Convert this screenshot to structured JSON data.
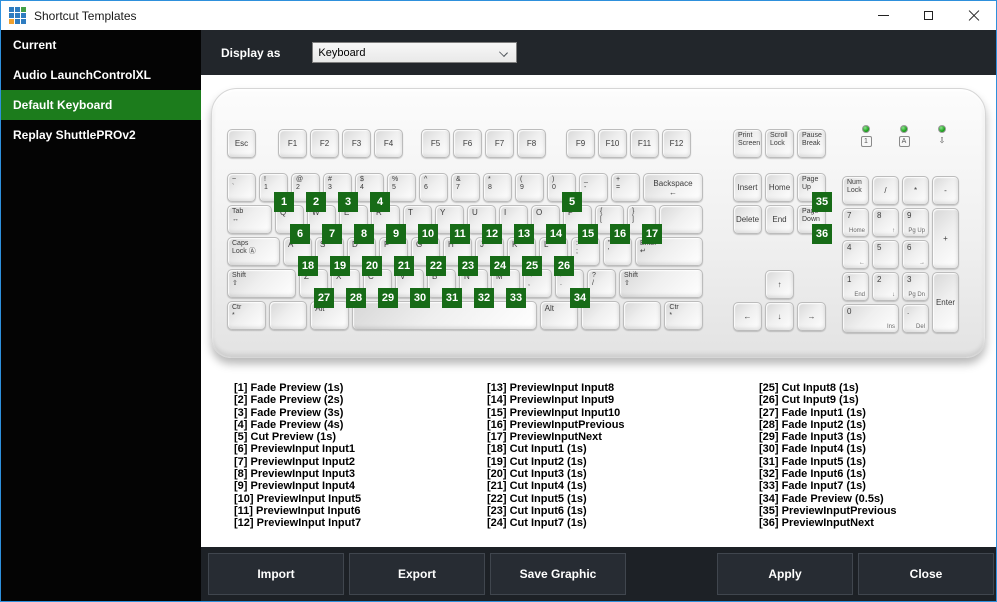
{
  "colors": {
    "accent_blue": "#2e90dc",
    "sidebar_bg": "#040404",
    "selected_green": "#1c7c1c",
    "badge_green": "#176b17",
    "header_bg": "#22262b",
    "footer_bg": "#1d2126",
    "button_bg": "#272c33",
    "button_border": "#40464e",
    "content_bg": "#ffffff"
  },
  "window": {
    "title": "Shortcut Templates",
    "app_icon_grid": [
      "#2e7cc0",
      "#2e7cc0",
      "#43a047",
      "#2e7cc0",
      "#2e7cc0",
      "#2e7cc0",
      "#f0a02c",
      "#2e7cc0",
      "#2e7cc0"
    ]
  },
  "sidebar": {
    "items": [
      {
        "label": "Current",
        "selected": false
      },
      {
        "label": "Audio LaunchControlXL",
        "selected": false
      },
      {
        "label": "Default Keyboard",
        "selected": true
      },
      {
        "label": "Replay ShuttlePROv2",
        "selected": false
      }
    ]
  },
  "header": {
    "label": "Display as",
    "dropdown_value": "Keyboard"
  },
  "keyboard": {
    "leds": [
      {
        "glyph": "1",
        "boxed": true
      },
      {
        "glyph": "A",
        "boxed": true
      },
      {
        "glyph": "⇩",
        "boxed": false
      }
    ],
    "main_rows": [
      [
        {
          "l": "Esc",
          "c": 1
        },
        {
          "sp": 16
        },
        {
          "l": "F1",
          "c": 1
        },
        {
          "l": "F2",
          "c": 1
        },
        {
          "l": "F3",
          "c": 1
        },
        {
          "l": "F4",
          "c": 1
        },
        {
          "sp": 12
        },
        {
          "l": "F5",
          "c": 1
        },
        {
          "l": "F6",
          "c": 1
        },
        {
          "l": "F7",
          "c": 1
        },
        {
          "l": "F8",
          "c": 1
        },
        {
          "sp": 14
        },
        {
          "l": "F9",
          "c": 1
        },
        {
          "l": "F10",
          "c": 1
        },
        {
          "l": "F11",
          "c": 1
        },
        {
          "l": "F12",
          "c": 1
        }
      ],
      [
        {
          "t": "~",
          "b": "`"
        },
        {
          "t": "!",
          "b": "1",
          "badge": "1"
        },
        {
          "t": "@",
          "b": "2",
          "badge": "2"
        },
        {
          "t": "#",
          "b": "3",
          "badge": "3"
        },
        {
          "t": "$",
          "b": "4",
          "badge": "4"
        },
        {
          "t": "%",
          "b": "5"
        },
        {
          "t": "^",
          "b": "6"
        },
        {
          "t": "&",
          "b": "7"
        },
        {
          "t": "*",
          "b": "8"
        },
        {
          "t": "(",
          "b": "9"
        },
        {
          "t": ")",
          "b": "0",
          "badge": "5"
        },
        {
          "t": "_",
          "b": "-"
        },
        {
          "t": "+",
          "b": "="
        },
        {
          "l": "Backspace",
          "i": "←",
          "fill": 1,
          "c": 1
        }
      ],
      [
        {
          "t": "Tab",
          "b": "↔",
          "w": 1.5
        },
        {
          "l": "Q",
          "badge": "6"
        },
        {
          "l": "W",
          "badge": "7"
        },
        {
          "l": "E",
          "badge": "8"
        },
        {
          "l": "R",
          "badge": "9"
        },
        {
          "l": "T",
          "badge": "10"
        },
        {
          "l": "Y",
          "badge": "11"
        },
        {
          "l": "U",
          "badge": "12"
        },
        {
          "l": "I",
          "badge": "13"
        },
        {
          "l": "O",
          "badge": "14"
        },
        {
          "l": "P",
          "badge": "15"
        },
        {
          "t": "{",
          "b": "[",
          "badge": "16"
        },
        {
          "t": "}",
          "b": "]",
          "badge": "17"
        },
        {
          "blank": 1,
          "fill": 1
        }
      ],
      [
        {
          "t": "Caps",
          "b": "Lock Ⓐ",
          "w": 1.75
        },
        {
          "l": "A",
          "badge": "18"
        },
        {
          "l": "S",
          "badge": "19"
        },
        {
          "l": "D",
          "badge": "20"
        },
        {
          "l": "F",
          "badge": "21"
        },
        {
          "l": "G",
          "badge": "22"
        },
        {
          "l": "H",
          "badge": "23"
        },
        {
          "l": "J",
          "badge": "24"
        },
        {
          "l": "K",
          "badge": "25"
        },
        {
          "l": "L",
          "badge": "26"
        },
        {
          "t": ":",
          "b": ";"
        },
        {
          "t": "\"",
          "b": "'"
        },
        {
          "t": "Enter",
          "b": "↵",
          "fill": 1
        }
      ],
      [
        {
          "t": "Shift",
          "b": "⇧",
          "w": 2.25
        },
        {
          "l": "Z",
          "badge": "27"
        },
        {
          "l": "X",
          "badge": "28"
        },
        {
          "l": "C",
          "badge": "29"
        },
        {
          "l": "V",
          "badge": "30"
        },
        {
          "l": "B",
          "badge": "31"
        },
        {
          "l": "N",
          "badge": "32"
        },
        {
          "l": "M",
          "badge": "33"
        },
        {
          "t": "<",
          "b": ","
        },
        {
          "t": ">",
          "b": ".",
          "badge": "34"
        },
        {
          "t": "?",
          "b": "/"
        },
        {
          "t": "Shift",
          "b": "⇧",
          "fill": 1
        }
      ],
      [
        {
          "t": "Ctr",
          "b": "*",
          "w": 1.3
        },
        {
          "blank": 1,
          "w": 1.3
        },
        {
          "l": "Alt",
          "w": 1.3
        },
        {
          "blank": 1,
          "fill": 1,
          "n": "space"
        },
        {
          "l": "Alt",
          "w": 1.3
        },
        {
          "blank": 1,
          "w": 1.3
        },
        {
          "blank": 1,
          "w": 1.3
        },
        {
          "t": "Ctr",
          "b": "*",
          "w": 1.3
        }
      ]
    ],
    "nav_rows": [
      [
        {
          "t": "Print",
          "b": "Screen"
        },
        {
          "t": "Scroll",
          "b": "Lock"
        },
        {
          "t": "Pause",
          "b": "Break"
        }
      ],
      [
        {
          "l": "Insert",
          "c": 1
        },
        {
          "l": "Home",
          "c": 1
        },
        {
          "t": "Page",
          "b": "Up",
          "badge": "35"
        }
      ],
      [
        {
          "l": "Delete",
          "c": 1
        },
        {
          "l": "End",
          "c": 1
        },
        {
          "t": "Page",
          "b": "Down",
          "badge": "36"
        }
      ]
    ],
    "arrows": {
      "up": "↑",
      "left": "←",
      "down": "↓",
      "right": "→"
    },
    "numpad": [
      {
        "t": "Num",
        "b": "Lock"
      },
      {
        "l": "/",
        "c": 1
      },
      {
        "l": "*",
        "c": 1
      },
      {
        "l": "-",
        "c": 1
      },
      {
        "l": "7",
        "s": "Home"
      },
      {
        "l": "8",
        "s": "↑"
      },
      {
        "l": "9",
        "s": "Pg Up"
      },
      {
        "l": "+",
        "c": 1,
        "rs": 2
      },
      {
        "l": "4",
        "s": "←"
      },
      {
        "l": "5"
      },
      {
        "l": "6",
        "s": "→"
      },
      {
        "l": "1",
        "s": "End"
      },
      {
        "l": "2",
        "s": "↓"
      },
      {
        "l": "3",
        "s": "Pg Dn"
      },
      {
        "l": "Enter",
        "c": 1,
        "rs": 2
      },
      {
        "l": "0",
        "s": "Ins",
        "cs": 2
      },
      {
        "l": ".",
        "s": "Del"
      }
    ]
  },
  "shortcuts": {
    "columns": [
      [
        "[1] Fade Preview (1s)",
        "[2] Fade Preview (2s)",
        "[3] Fade Preview (3s)",
        "[4] Fade Preview (4s)",
        "[5] Cut Preview (1s)",
        "[6] PreviewInput Input1",
        "[7] PreviewInput Input2",
        "[8] PreviewInput Input3",
        "[9] PreviewInput Input4",
        "[10] PreviewInput Input5",
        "[11] PreviewInput Input6",
        "[12] PreviewInput Input7"
      ],
      [
        "[13] PreviewInput Input8",
        "[14] PreviewInput Input9",
        "[15] PreviewInput Input10",
        "[16] PreviewInputPrevious",
        "[17] PreviewInputNext",
        "[18] Cut Input1 (1s)",
        "[19] Cut Input2 (1s)",
        "[20] Cut Input3 (1s)",
        "[21] Cut Input4 (1s)",
        "[22] Cut Input5 (1s)",
        "[23] Cut Input6 (1s)",
        "[24] Cut Input7 (1s)"
      ],
      [
        "[25] Cut Input8 (1s)",
        "[26] Cut Input9 (1s)",
        "[27] Fade Input1 (1s)",
        "[28] Fade Input2 (1s)",
        "[29] Fade Input3 (1s)",
        "[30] Fade Input4 (1s)",
        "[31] Fade Input5 (1s)",
        "[32] Fade Input6 (1s)",
        "[33] Fade Input7 (1s)",
        "[34] Fade Preview (0.5s)",
        "[35] PreviewInputPrevious",
        "[36] PreviewInputNext"
      ]
    ]
  },
  "footer": {
    "buttons": [
      "Import",
      "Export",
      "Save Graphic",
      "Apply",
      "Close"
    ]
  }
}
